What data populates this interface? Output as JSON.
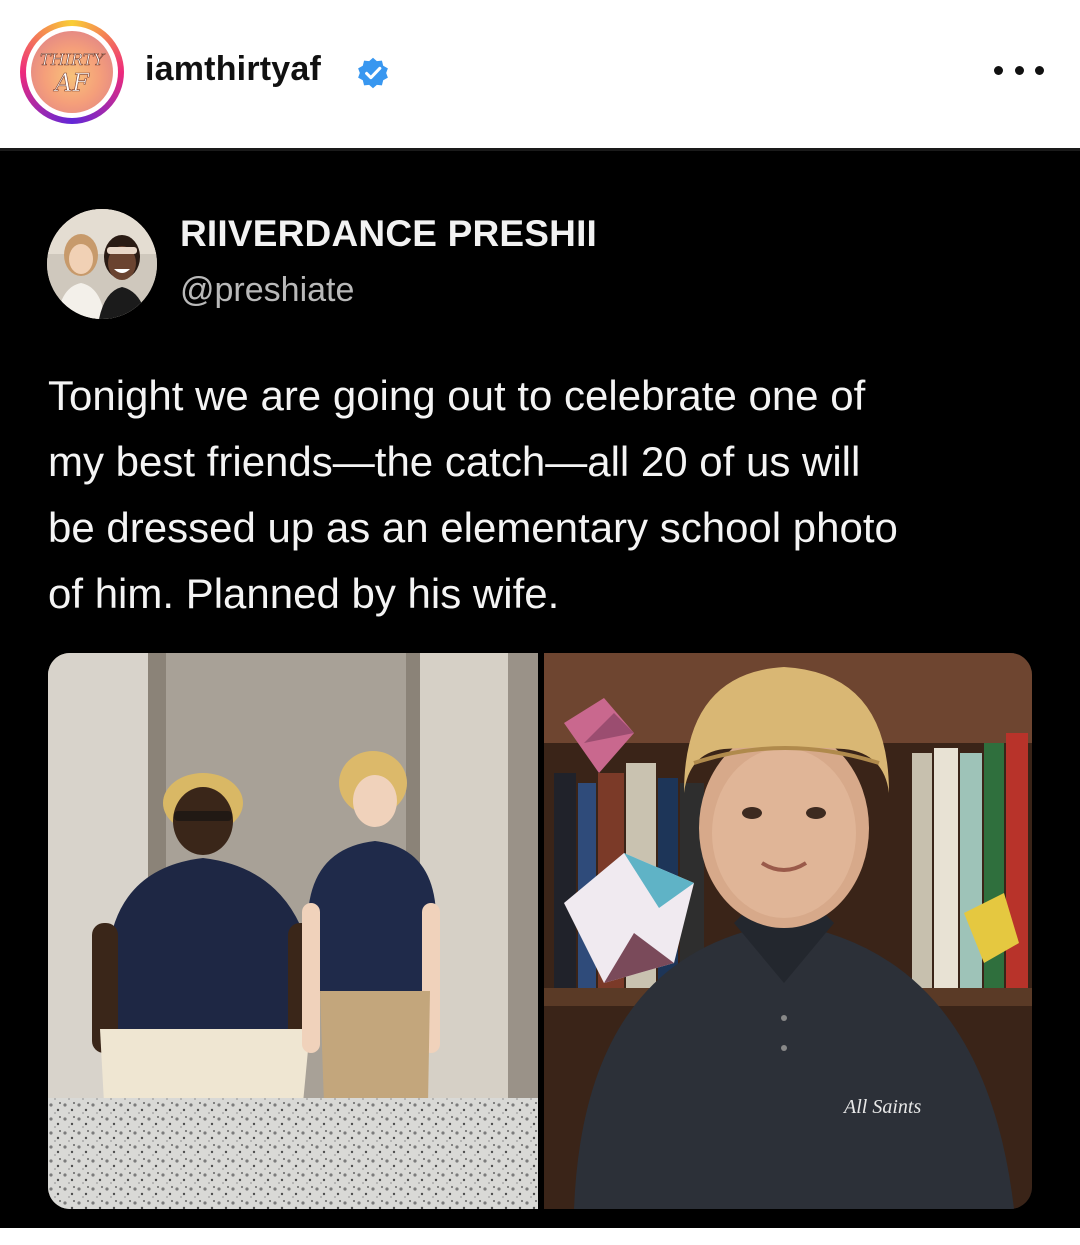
{
  "instagram": {
    "username": "iamthirtyaf",
    "avatar_logo_text_top": "THIRTY",
    "avatar_logo_text_bottom": "AF",
    "verified_icon": "verified-badge-icon",
    "more_icon": "more-options-icon",
    "accent_verified": "#3897f0"
  },
  "tweet": {
    "display_name": "RIIVERDANCE PRESHII",
    "handle": "@preshiate",
    "text_lines": [
      "Tonight we are going out to celebrate one of",
      "my best friends—the catch—all 20 of us will",
      "be dressed up as an elementary school photo",
      "of him. Planned by his wife."
    ],
    "photo_shirt_logo_text": "All Saints"
  },
  "colors": {
    "tweet_background": "#000000",
    "tweet_text": "#f4f4f4",
    "handle_text": "#b9b9b9"
  }
}
